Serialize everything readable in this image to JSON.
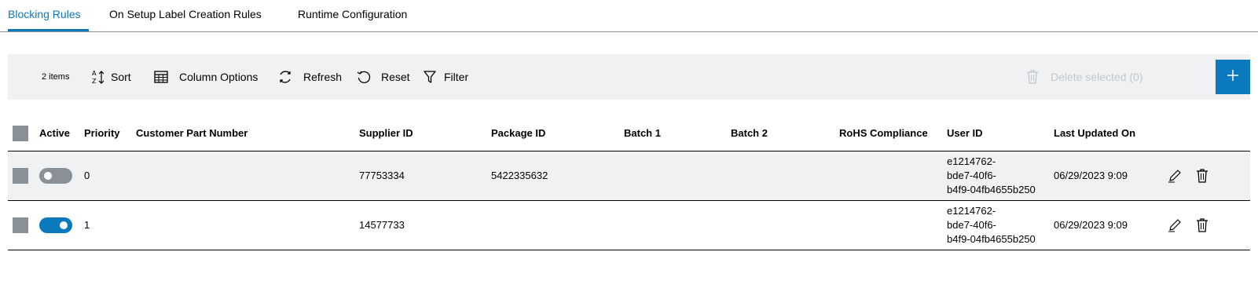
{
  "tabs": [
    {
      "label": "Blocking Rules",
      "active": true
    },
    {
      "label": "On Setup Label Creation Rules",
      "active": false
    },
    {
      "label": "Runtime Configuration",
      "active": false
    }
  ],
  "toolbar": {
    "item_count": "2 items",
    "sort": {
      "label": "Sort",
      "icon": "sort-icon"
    },
    "column_options": {
      "label": "Column Options",
      "icon": "table-icon"
    },
    "refresh": {
      "label": "Refresh",
      "icon": "refresh-icon"
    },
    "reset": {
      "label": "Reset",
      "icon": "reset-icon"
    },
    "filter": {
      "label": "Filter",
      "icon": "filter-icon"
    },
    "delete_selected": {
      "label": "Delete selected (0)",
      "icon": "trash-icon",
      "enabled": false
    },
    "add": {
      "icon": "plus-icon"
    }
  },
  "table": {
    "columns": [
      "Active",
      "Priority",
      "Customer Part Number",
      "Supplier ID",
      "Package ID",
      "Batch 1",
      "Batch 2",
      "RoHS Compliance",
      "User ID",
      "Last Updated On"
    ],
    "rows": [
      {
        "active": false,
        "priority": "0",
        "customer_part_number": "",
        "supplier_id": "77753334",
        "package_id": "5422335632",
        "batch1": "",
        "batch2": "",
        "rohs": "",
        "user_id": [
          "e1214762-",
          "bde7-40f6-",
          "b4f9-04fb4655b250"
        ],
        "last_updated": "06/29/2023 9:09"
      },
      {
        "active": true,
        "priority": "1",
        "customer_part_number": "",
        "supplier_id": "14577733",
        "package_id": "",
        "batch1": "",
        "batch2": "",
        "rohs": "",
        "user_id": [
          "e1214762-",
          "bde7-40f6-",
          "b4f9-04fb4655b250"
        ],
        "last_updated": "06/29/2023 9:09"
      }
    ]
  },
  "colors": {
    "accent": "#0a79be",
    "toolbar_bg": "#eff1f2",
    "control_gray": "#8a9097",
    "disabled_text": "#c1c7cc"
  }
}
